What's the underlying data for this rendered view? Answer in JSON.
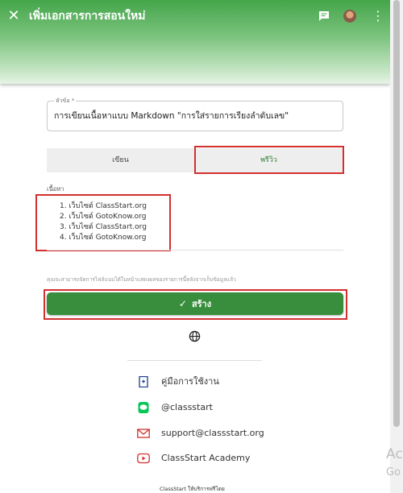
{
  "header": {
    "title": "เพิ่มเอกสารการสอนใหม่"
  },
  "form": {
    "title_label": "หัวข้อ *",
    "title_value": "การเขียนเนื้อหาแบบ Markdown \"การใส่รายการเรียงลำดับเลข\"",
    "tabs": [
      {
        "label": "เขียน",
        "active": false
      },
      {
        "label": "พรีวิว",
        "active": true
      }
    ],
    "content_label": "เนื้อหา",
    "preview_items": [
      "1. เว็บไซต์ ClassStart.org",
      "2. เว็บไซต์ GotoKnow.org",
      "3. เว็บไซต์ ClassStart.org",
      "4. เว็บไซต์ GotoKnow.org"
    ],
    "hint": "คุณจะสามารถจัดการไฟล์แนบได้ในหน้าแสดงผลของรายการนี้หลังจากเก็บข้อมูลแล้ว",
    "create_label": "สร้าง"
  },
  "links": [
    {
      "label": "คู่มือการใช้งาน",
      "icon": "book-icon"
    },
    {
      "label": "@classstart",
      "icon": "line-icon"
    },
    {
      "label": "support@classstart.org",
      "icon": "mail-icon"
    },
    {
      "label": "ClassStart Academy",
      "icon": "youtube-icon"
    }
  ],
  "footer": "ClassStart ให้บริการฟรีโดย",
  "watermark": [
    "Ac",
    "Go"
  ],
  "colors": {
    "primary": "#388e3c",
    "highlight": "#d32f2f"
  }
}
